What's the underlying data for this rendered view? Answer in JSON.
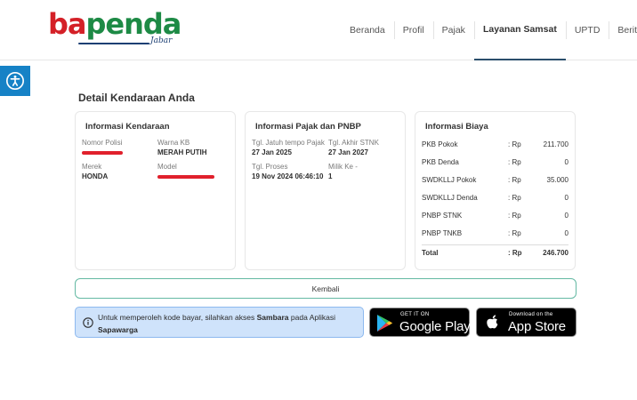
{
  "brand": {
    "logo_main": "bapenda",
    "logo_sub": "Jabar",
    "colors": {
      "red": "#d42027",
      "green": "#1d8a45",
      "navy": "#1c3f73"
    }
  },
  "nav": {
    "items": [
      {
        "label": "Beranda"
      },
      {
        "label": "Profil"
      },
      {
        "label": "Pajak"
      },
      {
        "label": "Layanan Samsat",
        "active": true
      },
      {
        "label": "UPTD"
      },
      {
        "label": "Berit"
      }
    ]
  },
  "accessibility": {
    "icon": "accessibility-icon"
  },
  "page": {
    "title": "Detail Kendaraan Anda"
  },
  "vehicle": {
    "title": "Informasi Kendaraan",
    "nomor_polisi_label": "Nomor Polisi",
    "warna_kb_label": "Warna KB",
    "warna_kb_value": "MERAH PUTIH",
    "merek_label": "Merek",
    "merek_value": "HONDA",
    "model_label": "Model"
  },
  "tax": {
    "title": "Informasi Pajak dan PNBP",
    "jatuh_tempo_label": "Tgl. Jatuh tempo Pajak",
    "jatuh_tempo_value": "27 Jan 2025",
    "akhir_stnk_label": "Tgl. Akhir STNK",
    "akhir_stnk_value": "27 Jan 2027",
    "proses_label": "Tgl. Proses",
    "proses_value": "19 Nov 2024 06:46:10",
    "milik_label": "Milik Ke -",
    "milik_value": "1"
  },
  "costs": {
    "title": "Informasi Biaya",
    "rows": [
      {
        "name": "PKB Pokok",
        "currency": ": Rp",
        "amount": "211.700"
      },
      {
        "name": "PKB Denda",
        "currency": ": Rp",
        "amount": "0"
      },
      {
        "name": "SWDKLLJ Pokok",
        "currency": ": Rp",
        "amount": "35.000"
      },
      {
        "name": "SWDKLLJ Denda",
        "currency": ": Rp",
        "amount": "0"
      },
      {
        "name": "PNBP STNK",
        "currency": ": Rp",
        "amount": "0"
      },
      {
        "name": "PNBP TNKB",
        "currency": ": Rp",
        "amount": "0"
      }
    ],
    "total": {
      "name": "Total",
      "currency": ": Rp",
      "amount": "246.700"
    }
  },
  "actions": {
    "back_label": "Kembali"
  },
  "info": {
    "text_before": "Untuk memperoleh kode bayar, silahkan akses ",
    "app_name": "Sambara",
    "text_middle": " pada Aplikasi ",
    "app_name_2": "Sapawarga",
    "icon": "info-icon",
    "bg_color": "#cfe3fb"
  },
  "stores": {
    "google": {
      "small": "GET IT ON",
      "big": "Google Play",
      "icon": "google-play-icon"
    },
    "apple": {
      "small": "Download on the",
      "big": "App Store",
      "icon": "apple-icon"
    }
  }
}
